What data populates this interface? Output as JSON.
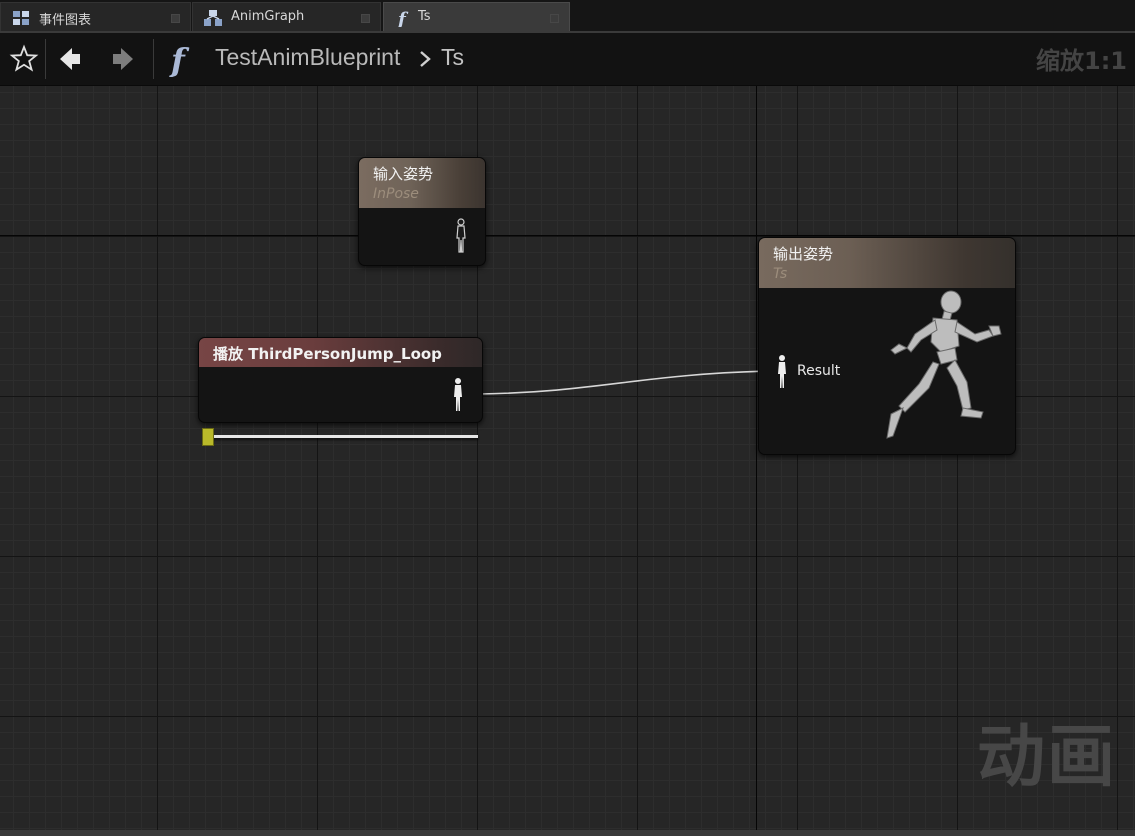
{
  "tabs": [
    {
      "label": "事件图表",
      "icon": "event-graph-icon",
      "active": false
    },
    {
      "label": "AnimGraph",
      "icon": "anim-graph-icon",
      "active": false
    },
    {
      "label": "Ts",
      "icon": "function-icon",
      "active": true
    }
  ],
  "toolbar": {
    "blueprint_name": "TestAnimBlueprint",
    "current_graph": "Ts",
    "zoom": "缩放1:1"
  },
  "canvas": {
    "watermark": "动画"
  },
  "nodes": {
    "input_pose": {
      "title": "输入姿势",
      "subtitle": "InPose"
    },
    "play": {
      "title": "播放 ThirdPersonJump_Loop",
      "play_position": 0
    },
    "output_pose": {
      "title": "输出姿势",
      "subtitle": "Ts",
      "pin_label": "Result"
    }
  },
  "colors": {
    "node_header_pose": "#7b6c60",
    "node_header_play": "#774545",
    "slider_handle": "#b9b92a",
    "grid_background": "#262626"
  }
}
